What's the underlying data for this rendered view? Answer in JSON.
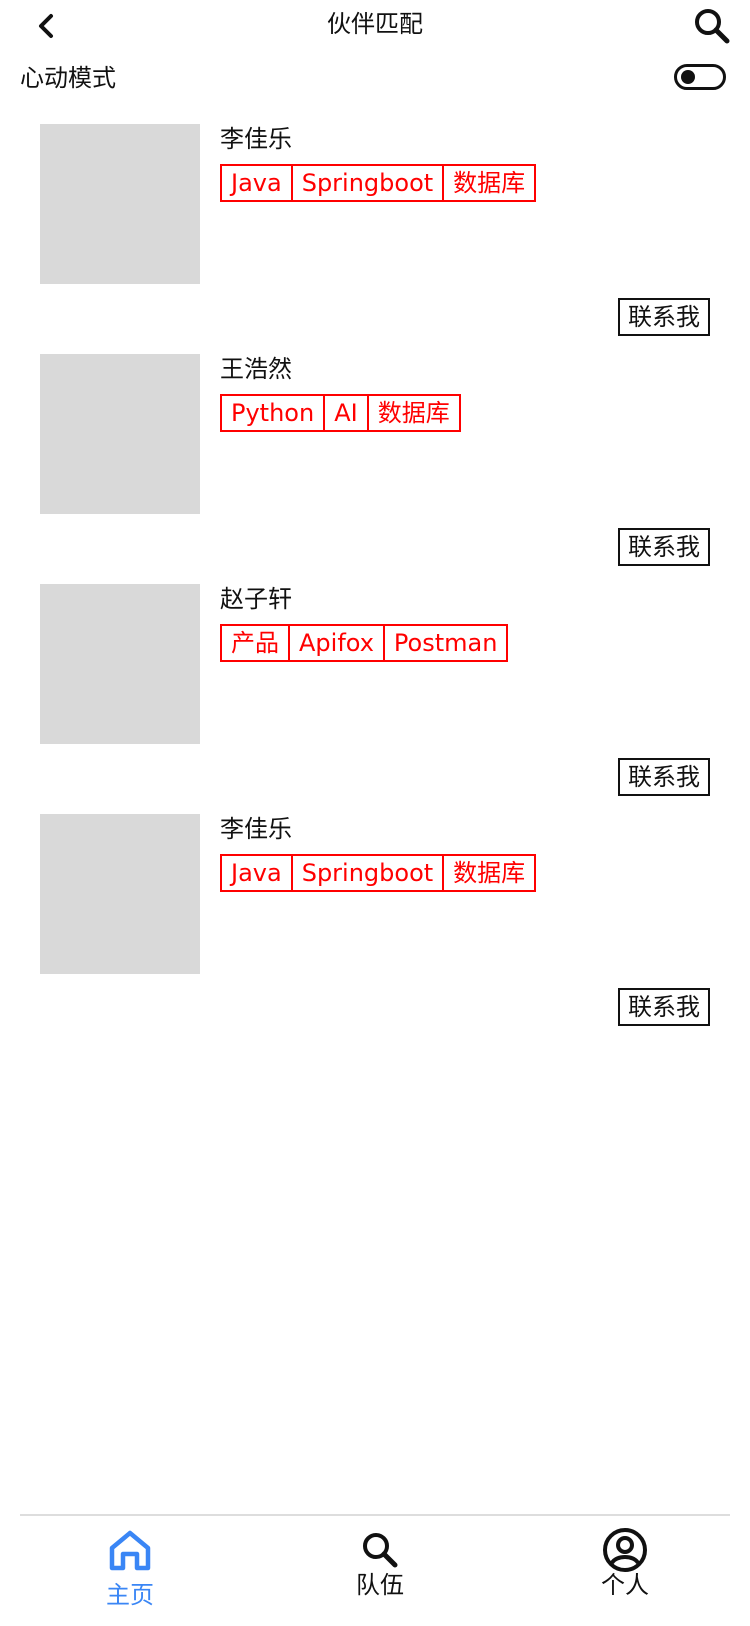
{
  "header": {
    "title": "伙伴匹配",
    "back_icon": "chevron-left-icon",
    "search_icon": "search-icon"
  },
  "mode": {
    "label": "心动模式",
    "toggle_on": false
  },
  "users": [
    {
      "name": "李佳乐",
      "tags": [
        "Java",
        "Springboot",
        "数据库"
      ],
      "contact_label": "联系我"
    },
    {
      "name": "王浩然",
      "tags": [
        "Python",
        "AI",
        "数据库"
      ],
      "contact_label": "联系我"
    },
    {
      "name": "赵子轩",
      "tags": [
        "产品",
        "Apifox",
        "Postman"
      ],
      "contact_label": "联系我"
    },
    {
      "name": "李佳乐",
      "tags": [
        "Java",
        "Springboot",
        "数据库"
      ],
      "contact_label": "联系我"
    }
  ],
  "bottom_nav": {
    "items": [
      {
        "label": "主页",
        "icon": "home-icon",
        "active": true
      },
      {
        "label": "队伍",
        "icon": "search-icon",
        "active": false
      },
      {
        "label": "个人",
        "icon": "user-icon",
        "active": false
      }
    ]
  },
  "colors": {
    "accent": "#3a86f5",
    "tag": "#ff0000",
    "avatar_placeholder": "#d9d9d9"
  }
}
